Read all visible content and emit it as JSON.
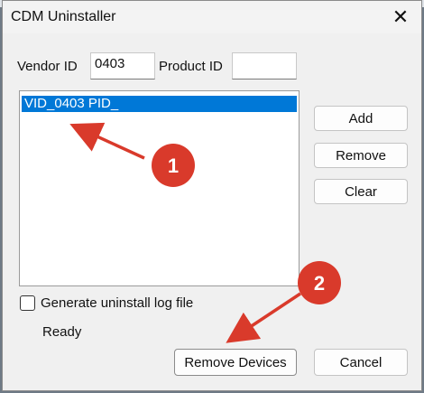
{
  "window": {
    "title": "CDM Uninstaller",
    "close_glyph": "✕"
  },
  "form": {
    "vendor_label": "Vendor ID",
    "vendor_value": "0403",
    "product_label": "Product ID",
    "product_value": ""
  },
  "device_list": {
    "items": [
      "VID_0403 PID_"
    ],
    "selected_index": 0
  },
  "buttons": {
    "add": "Add",
    "remove": "Remove",
    "clear": "Clear",
    "remove_devices": "Remove Devices",
    "cancel": "Cancel"
  },
  "options": {
    "log_label": "Generate uninstall log file",
    "log_checked": false
  },
  "status": {
    "text": "Ready"
  },
  "annotations": {
    "step1": "1",
    "step2": "2",
    "color": "#d93a2b"
  },
  "colors": {
    "selection": "#0078d7",
    "dialog_bg": "#f0f0f0"
  }
}
